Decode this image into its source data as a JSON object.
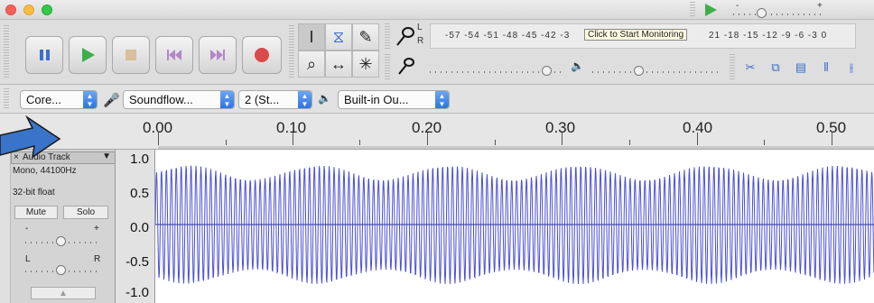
{
  "toolbar": {
    "transport": {
      "pause": "pause-icon",
      "play": "play-icon",
      "stop": "stop-icon",
      "skip_start": "skip-to-start-icon",
      "skip_end": "skip-to-end-icon",
      "record": "record-icon"
    },
    "tools": {
      "row1": [
        "I",
        "⧖",
        "✎"
      ],
      "row2": [
        "⌕",
        "↔",
        "✳"
      ]
    },
    "record_meter": {
      "channel_label_top": "L",
      "channel_label_bottom": "R",
      "scale": "-57 -54 -51 -48 -45 -42 -3",
      "tooltip": "Click to Start Monitoring",
      "scale_tail": "21 -18 -15 -12 -9 -6 -3 0"
    },
    "play_speed": {
      "value": 0.5
    }
  },
  "devices": {
    "host": "Core...",
    "input": "Soundflow...",
    "channels": "2 (St...",
    "output": "Built-in Ou..."
  },
  "ruler": {
    "ticks": [
      "0.00",
      "0.10",
      "0.20",
      "0.30",
      "0.40",
      "0.50"
    ]
  },
  "track": {
    "name": "Audio Track",
    "info1": "Mono, 44100Hz",
    "info2": "32-bit float",
    "mute_label": "Mute",
    "solo_label": "Solo",
    "gain_minus": "-",
    "gain_plus": "+",
    "pan_left": "L",
    "pan_right": "R",
    "scale": [
      "1.0",
      "0.5",
      "0.0",
      "-0.5",
      "-1.0"
    ]
  },
  "colors": {
    "waveform": "#4a4fd6",
    "record_red": "#d94a4a",
    "play_green": "#3fae4a",
    "pointer_arrow": "#3a74c8"
  }
}
